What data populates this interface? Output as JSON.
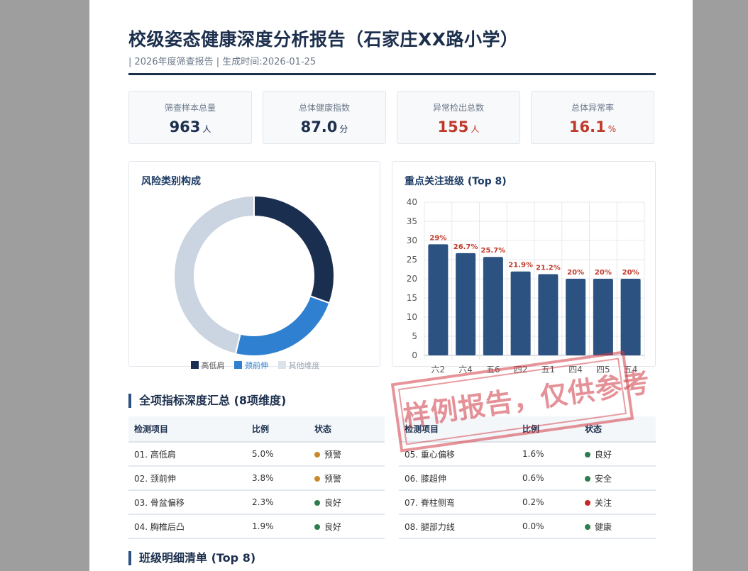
{
  "header": {
    "title": "校级姿态健康深度分析报告（石家庄XX路小学）",
    "subtitle": "| 2026年度筛查报告 | 生成时间:2026-01-25"
  },
  "kpis": [
    {
      "label": "筛查样本总量",
      "value": "963",
      "unit": "人"
    },
    {
      "label": "总体健康指数",
      "value": "87.0",
      "unit": "分"
    },
    {
      "label": "异常检出总数",
      "value": "155",
      "unit": "人"
    },
    {
      "label": "总体异常率",
      "value": "16.1",
      "unit": "%"
    }
  ],
  "colors": {
    "navy": "#1a2f50",
    "blue": "#2f80d0",
    "gray": "#cbd5e1",
    "bar": "#2c5282",
    "warn": "#c0392b",
    "status_warn": "#c8892b",
    "status_good": "#2e7d4f",
    "status_alert": "#c62828"
  },
  "panels": {
    "donut_title": "风险类别构成",
    "bar_title": "重点关注班级 (Top 8)"
  },
  "chart_data": [
    {
      "type": "pie",
      "title": "风险类别构成",
      "categories": [
        "高低肩",
        "颈前伸",
        "其他维度"
      ],
      "values": [
        30.5,
        23.2,
        46.3
      ],
      "colors": [
        "#1a2f50",
        "#2f80d0",
        "#cbd5e1"
      ],
      "legend": "bottom",
      "donut": true
    },
    {
      "type": "bar",
      "title": "重点关注班级 (Top 8)",
      "categories": [
        "六2",
        "六4",
        "五6",
        "四2",
        "五1",
        "四4",
        "四5",
        "五4"
      ],
      "values": [
        29,
        26.7,
        25.7,
        21.9,
        21.2,
        20,
        20,
        20
      ],
      "data_labels": [
        "29%",
        "26.7%",
        "25.7%",
        "21.9%",
        "21.2%",
        "20%",
        "20%",
        "20%"
      ],
      "ylim": [
        0,
        40
      ],
      "yticks": [
        0,
        5,
        10,
        15,
        20,
        25,
        30,
        35,
        40
      ],
      "grid": true,
      "color": "#2c5282"
    }
  ],
  "sections": {
    "indicators_title": "全项指标深度汇总 (8项维度)",
    "classes_title": "班级明细清单 (Top 8)"
  },
  "indicator_table": {
    "headers": [
      "检测项目",
      "比例",
      "状态"
    ],
    "left": [
      {
        "name": "01. 高低肩",
        "ratio": "5.0%",
        "status": "预警",
        "level": "warn"
      },
      {
        "name": "02. 颈前伸",
        "ratio": "3.8%",
        "status": "预警",
        "level": "warn"
      },
      {
        "name": "03. 骨盆偏移",
        "ratio": "2.3%",
        "status": "良好",
        "level": "good"
      },
      {
        "name": "04. 胸椎后凸",
        "ratio": "1.9%",
        "status": "良好",
        "level": "good"
      }
    ],
    "right": [
      {
        "name": "05. 重心偏移",
        "ratio": "1.6%",
        "status": "良好",
        "level": "good"
      },
      {
        "name": "06. 膝超伸",
        "ratio": "0.6%",
        "status": "安全",
        "level": "good"
      },
      {
        "name": "07. 脊柱侧弯",
        "ratio": "0.2%",
        "status": "关注",
        "level": "alert"
      },
      {
        "name": "08. 腿部力线",
        "ratio": "0.0%",
        "status": "健康",
        "level": "good"
      }
    ]
  },
  "stamp": {
    "text": "样例报告，仅供参考"
  }
}
